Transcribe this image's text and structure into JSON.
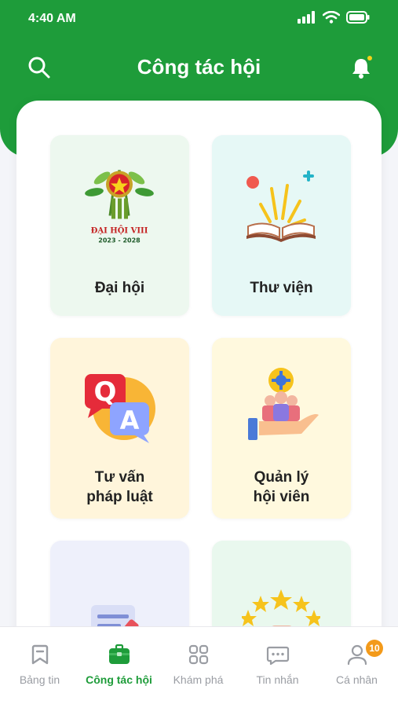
{
  "status": {
    "time": "4:40 AM"
  },
  "header": {
    "title": "Công tác hội"
  },
  "cards": [
    {
      "label": "Đại hội",
      "emblem_title": "ĐẠI HỘI VIII",
      "emblem_years": "2023 - 2028",
      "bg": "#edf8ef"
    },
    {
      "label": "Thư viện",
      "bg": "#e6f8f6"
    },
    {
      "label_lines": [
        "Tư vấn",
        "pháp luật"
      ],
      "qa_letters": [
        "Q",
        "A"
      ],
      "bg": "#fff5db"
    },
    {
      "label_lines": [
        "Quản lý",
        "hội viên"
      ],
      "bg": "#fff9de"
    },
    {
      "label": "",
      "bg": "#eef0fb"
    },
    {
      "label": "",
      "bg": "#e9f8ee"
    }
  ],
  "nav": {
    "items": [
      {
        "label": "Bảng tin",
        "icon": "bookmark-icon"
      },
      {
        "label": "Công tác hội",
        "icon": "briefcase-icon"
      },
      {
        "label": "Khám phá",
        "icon": "grid-icon"
      },
      {
        "label": "Tin nhắn",
        "icon": "message-icon"
      },
      {
        "label": "Cá nhân",
        "icon": "user-icon",
        "badge": "10"
      }
    ],
    "active": "Công tác hội"
  },
  "colors": {
    "primary": "#1e9c3a",
    "badge": "#f39a1a",
    "inactive": "#9a9da3"
  }
}
